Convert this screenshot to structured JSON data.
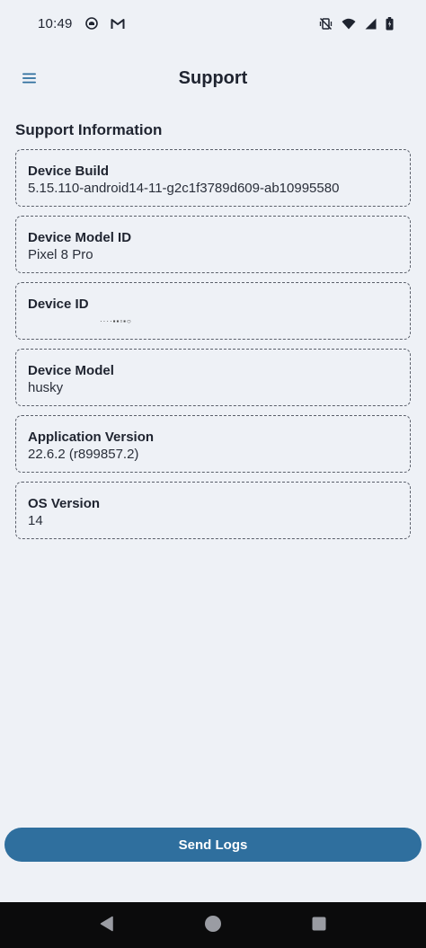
{
  "status_bar": {
    "time": "10:49",
    "left_icons": [
      "circle-notification-icon",
      "gmail-icon"
    ],
    "right_icons": [
      "vibrate-off-icon",
      "wifi-icon",
      "signal-icon",
      "battery-charging-icon"
    ]
  },
  "app_bar": {
    "title": "Support",
    "menu_icon": "menu-icon"
  },
  "section": {
    "heading": "Support Information"
  },
  "cards": [
    {
      "label": "Device Build",
      "value": "5.15.110-android14-11-g2c1f3789d609-ab10995580"
    },
    {
      "label": "Device Model ID",
      "value": "Pixel 8 Pro"
    },
    {
      "label": "Device ID",
      "value": "····▪▪▫▪○"
    },
    {
      "label": "Device Model",
      "value": "husky"
    },
    {
      "label": "Application Version",
      "value": "22.6.2 (r899857.2)"
    },
    {
      "label": "OS Version",
      "value": "14"
    }
  ],
  "actions": {
    "send_logs_label": "Send Logs"
  },
  "nav_bar": {
    "icons": [
      "back-icon",
      "home-icon",
      "recents-icon"
    ]
  },
  "colors": {
    "background": "#eef1f6",
    "accent": "#2f6f9e",
    "text": "#1f2430",
    "nav_bar": "#0b0b0c"
  }
}
